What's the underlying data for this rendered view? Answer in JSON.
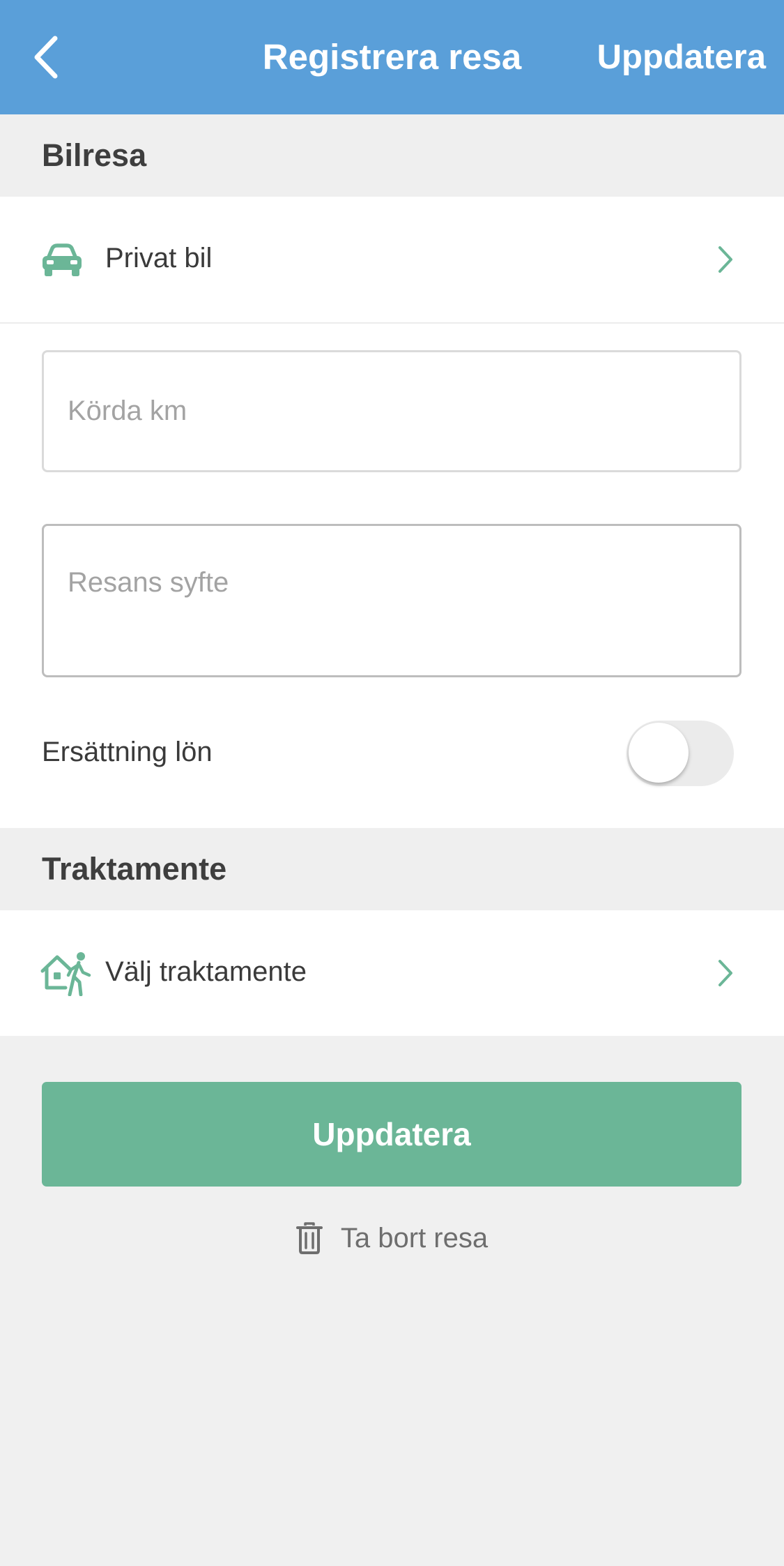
{
  "header": {
    "title": "Registrera resa",
    "action_label": "Uppdatera",
    "background": "#5a9fd9"
  },
  "sections": {
    "car_trip": {
      "title": "Bilresa",
      "vehicle_row": {
        "icon": "car-icon",
        "label": "Privat bil"
      },
      "km_field": {
        "placeholder": "Körda km",
        "value": ""
      },
      "purpose_field": {
        "placeholder": "Resans syfte",
        "value": ""
      },
      "salary_toggle": {
        "label": "Ersättning lön",
        "on": false
      }
    },
    "allowance": {
      "title": "Traktamente",
      "select_row": {
        "icon": "house-walking-person-icon",
        "label": "Välj traktamente"
      }
    }
  },
  "actions": {
    "primary_label": "Uppdatera",
    "primary_color": "#6bb697",
    "delete_label": "Ta bort resa",
    "delete_icon": "trash-icon"
  },
  "colors": {
    "accent": "#6bb697",
    "header": "#5a9fd9",
    "background": "#f0f0f0"
  }
}
